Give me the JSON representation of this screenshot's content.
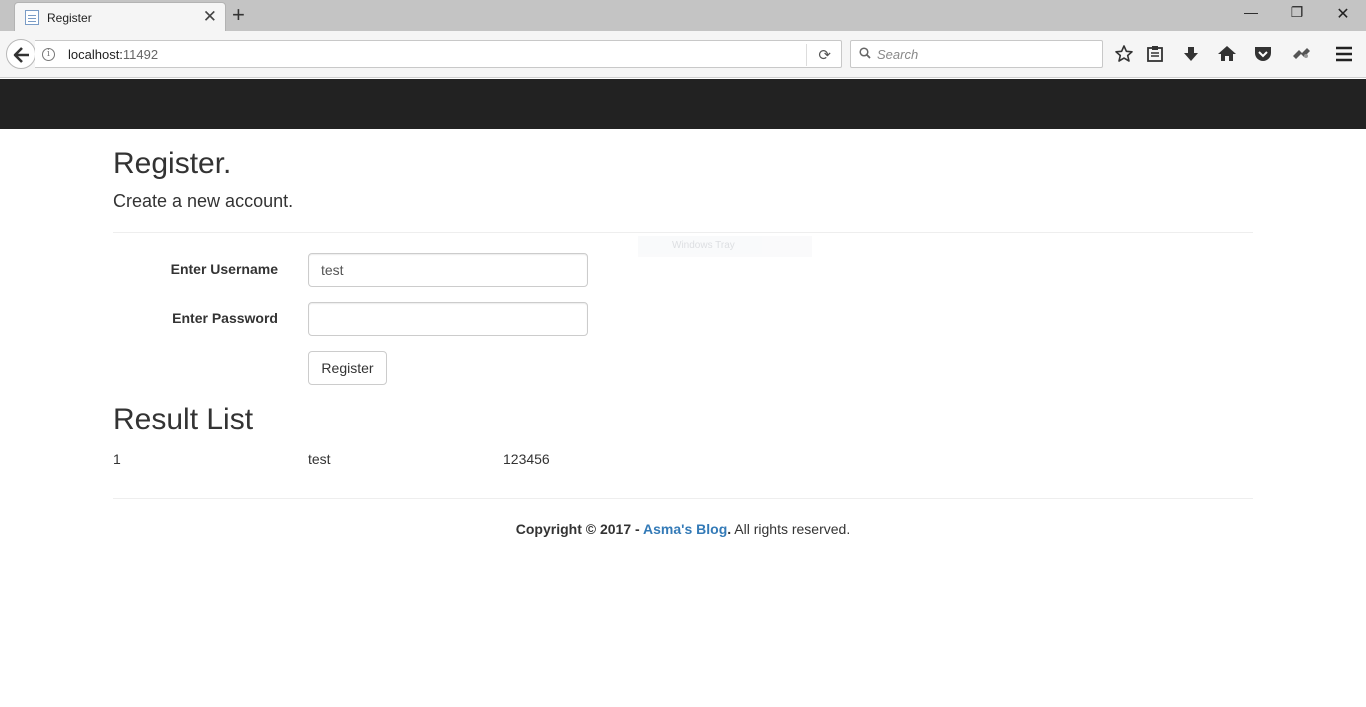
{
  "browser": {
    "tab_title": "Register",
    "url_host": "localhost:",
    "url_port": "11492",
    "search_placeholder": "Search"
  },
  "page": {
    "title": "Register.",
    "subtitle": "Create a new account.",
    "form": {
      "username_label": "Enter Username",
      "username_value": "test",
      "password_label": "Enter Password",
      "password_value": "",
      "submit_label": "Register"
    },
    "results": {
      "title": "Result List",
      "rows": [
        {
          "id": "1",
          "username": "test",
          "password": "123456"
        }
      ]
    },
    "footer": {
      "copyright": "Copyright © 2017 - ",
      "blog_link": "Asma's Blog",
      "reserved": ". All rights reserved."
    },
    "overlay": {
      "ghost_text": "Windows Tray"
    }
  },
  "icons": {
    "tab_favicon": "page-icon",
    "tab_close": "close-icon",
    "new_tab": "plus-icon",
    "back": "back-arrow-icon",
    "info": "info-icon",
    "reload": "reload-icon",
    "search": "search-icon",
    "bookmark": "star-icon",
    "library": "clipboard-icon",
    "downloads": "download-icon",
    "home": "home-icon",
    "pocket": "pocket-icon",
    "extension": "extension-icon",
    "menu": "hamburger-icon"
  },
  "colors": {
    "site_navbar": "#222222",
    "link": "#337ab7"
  }
}
